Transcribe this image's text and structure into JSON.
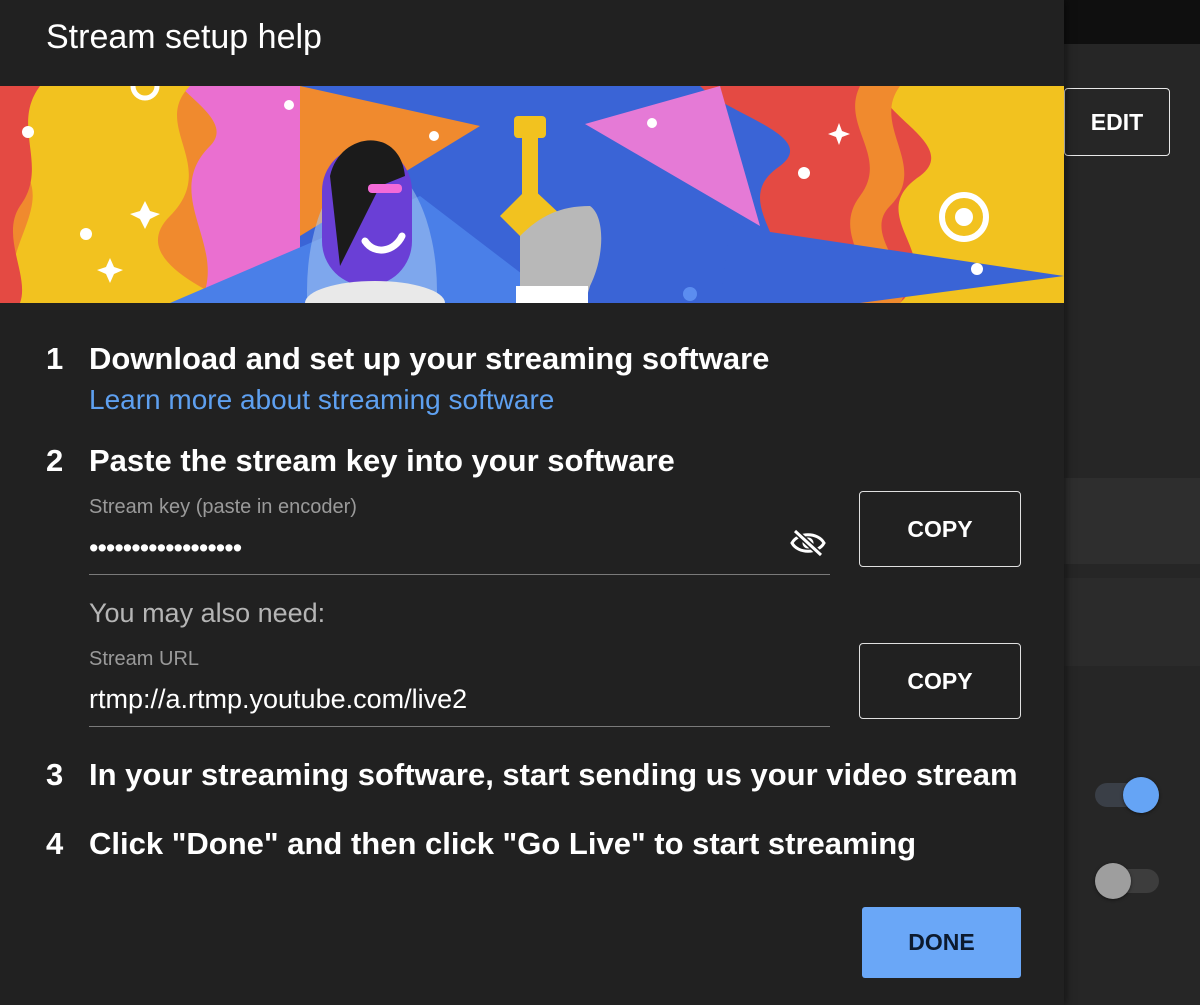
{
  "dialog": {
    "title": "Stream setup help",
    "steps": [
      {
        "number": "1",
        "text": "Download and set up your streaming software",
        "link": "Learn more about streaming software"
      },
      {
        "number": "2",
        "text": "Paste the stream key into your software"
      },
      {
        "number": "3",
        "text": "In your streaming software, start sending us your video stream"
      },
      {
        "number": "4",
        "text": "Click \"Done\" and then click \"Go Live\" to start streaming"
      }
    ],
    "stream_key": {
      "label": "Stream key (paste in encoder)",
      "value": "••••••••••••••••••",
      "visibility_icon": "eye-off-icon",
      "copy_label": "COPY"
    },
    "also_need": "You may also need:",
    "stream_url": {
      "label": "Stream URL",
      "value": "rtmp://a.rtmp.youtube.com/live2",
      "copy_label": "COPY"
    },
    "done_label": "DONE"
  },
  "background": {
    "edit_label": "EDIT",
    "toggles": [
      {
        "state": "on"
      },
      {
        "state": "off"
      }
    ]
  },
  "colors": {
    "accent": "#65a4f5",
    "dialog_bg": "#212121",
    "link": "#5ea0f0"
  }
}
